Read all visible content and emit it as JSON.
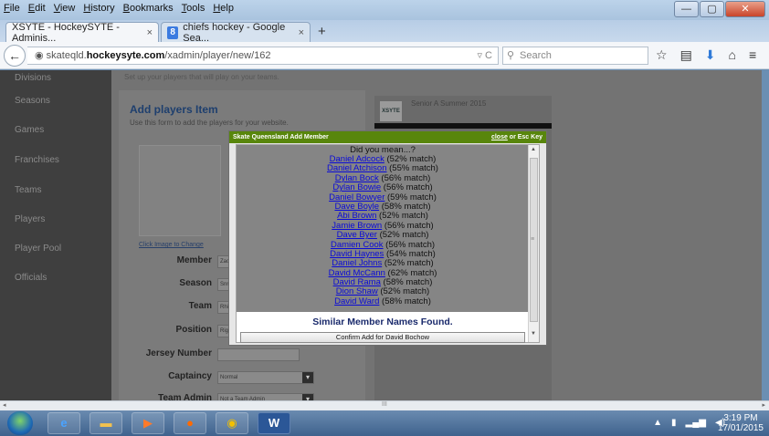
{
  "menu": [
    "File",
    "Edit",
    "View",
    "History",
    "Bookmarks",
    "Tools",
    "Help"
  ],
  "window_buttons": {
    "minimize": "—",
    "maximize": "▢",
    "close": "✕"
  },
  "tabs": [
    {
      "label": "XSYTE - HockeySYTE - Adminis...",
      "close": "×"
    },
    {
      "label": "chiefs hockey - Google Sea...",
      "close": "×"
    }
  ],
  "new_tab": "+",
  "url": {
    "prefix": "skateqld.",
    "domain": "hockeysyte.com",
    "path": "/xadmin/player/new/162"
  },
  "search_placeholder": "Search",
  "top_note": "Set up your players that will play on your teams.",
  "sidebar": [
    "Divisions",
    "Seasons",
    "Games",
    "Franchises",
    "Teams",
    "Players",
    "Player Pool",
    "Officials"
  ],
  "form": {
    "title": "Add players Item",
    "subtitle": "Use this form to add the players for your website.",
    "image_caption": "Click Image to Change",
    "fields": [
      {
        "label": "Member",
        "value": "Zach"
      },
      {
        "label": "Season",
        "value": "Snr A"
      },
      {
        "label": "Team",
        "value": "Rhino"
      },
      {
        "label": "Position",
        "value": "Right"
      },
      {
        "label": "Jersey Number",
        "value": ""
      },
      {
        "label": "Captaincy",
        "value": "Normal"
      },
      {
        "label": "Team Admin",
        "value": "Not a Team Admin"
      }
    ]
  },
  "right_panel": {
    "logo": "XSYTE",
    "title": "Senior A Summer 2015"
  },
  "modal": {
    "title": "Skate Queensland Add Member",
    "close_link": "close",
    "close_suffix": " or Esc Key",
    "heading": "Did you mean...?",
    "matches": [
      {
        "name": "Daniel Adcock",
        "pct": "(52% match)"
      },
      {
        "name": "Daniel Atchison",
        "pct": "(55% match)"
      },
      {
        "name": "Dylan Bock",
        "pct": "(56% match)"
      },
      {
        "name": "Dylan Bowie",
        "pct": "(56% match)"
      },
      {
        "name": "Daniel Bowyer",
        "pct": "(59% match)"
      },
      {
        "name": "Dave Boyle",
        "pct": "(58% match)"
      },
      {
        "name": "Abi Brown",
        "pct": "(52% match)"
      },
      {
        "name": "Jamie Brown",
        "pct": "(56% match)"
      },
      {
        "name": "Dave Byer",
        "pct": "(52% match)"
      },
      {
        "name": "Damien Cook",
        "pct": "(56% match)"
      },
      {
        "name": "David Haynes",
        "pct": "(54% match)"
      },
      {
        "name": "Daniel Johns",
        "pct": "(52% match)"
      },
      {
        "name": "David McCann",
        "pct": "(62% match)"
      },
      {
        "name": "David Rama",
        "pct": "(58% match)"
      },
      {
        "name": "Dion Shaw",
        "pct": "(52% match)"
      },
      {
        "name": "David Ward",
        "pct": "(58% match)"
      }
    ],
    "similar_text": "Similar Member Names Found.",
    "confirm_label": "Confirm Add for David Bochow"
  },
  "taskbar": {
    "word_label": "W"
  },
  "clock": {
    "time": "3:19 PM",
    "date": "17/01/2015"
  }
}
